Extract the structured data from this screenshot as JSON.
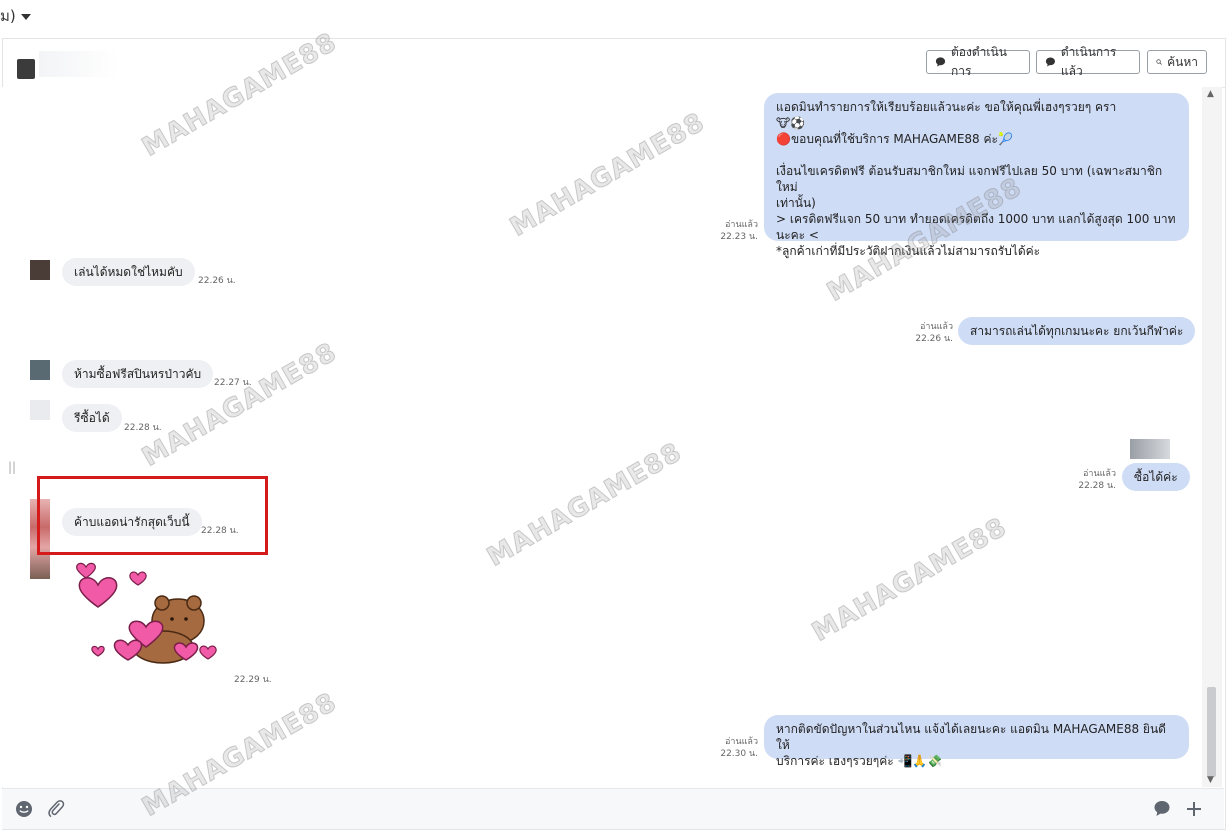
{
  "topbar": {
    "selector_text": "ม)"
  },
  "header": {
    "btn_pending": "ต้องดำเนินการ",
    "btn_done": "ดำเนินการแล้ว",
    "btn_search": "ค้นหา"
  },
  "messages": {
    "m1": {
      "lines": [
        "แอดมินทำรายการให้เรียบร้อยแล้วนะค่ะ ขอให้คุณพี่เฮงๆรวยๆ ครา",
        "🐮⚽",
        "🔴ขอบคุณที่ใช้บริการ MAHAGAME88 ค่ะ🎾",
        "",
        "เงื่อนไขเครดิตฟรี ต้อนรับสมาชิกใหม่ แจกฟรีไปเลย 50 บาท (เฉพาะสมาชิกใหม่",
        "เท่านั้น)",
        "> เครดิตฟรีแจก 50 บาท ทำยอดเครดิตถึง 1000 บาท แลกได้สูงสุด 100 บาท",
        "นะคะ <",
        "*ลูกค้าเก่าที่มีประวัติฝากเงินแล้วไม่สามารถรับได้ค่ะ"
      ],
      "read": "อ่านแล้ว",
      "time": "22.23 น."
    },
    "m2": {
      "text": "เล่นได้หมดใช่ไหมคับ",
      "time": "22.26 น."
    },
    "m3": {
      "text": "สามารถเล่นได้ทุกเกมนะคะ ยกเว้นกีฬาค่ะ",
      "read": "อ่านแล้ว",
      "time": "22.26 น."
    },
    "m4": {
      "text": "ห้ามซื้อฟรีสปินหรป่าวคับ",
      "time": "22.27 น."
    },
    "m5": {
      "text": "รีซื้อได้",
      "time": "22.28 น."
    },
    "m6": {
      "text": "ซื้อได้ค่ะ",
      "read": "อ่านแล้ว",
      "time": "22.28 น."
    },
    "m7": {
      "text": "ค้าบแอดน่ารักสุดเว็บนี้",
      "time": "22.28 น."
    },
    "m8": {
      "time": "22.29 น."
    },
    "m9": {
      "lines": [
        "หากติดขัดปัญหาในส่วนไหน แจ้งได้เลยนะคะ แอดมิน MAHAGAME88 ยินดีให้",
        "บริการค่ะ เฮงๆรวยๆค่ะ 📲🙏💸"
      ],
      "read": "อ่านแล้ว",
      "time": "22.30 น."
    }
  },
  "watermark": "MAHAGAME88",
  "colors": {
    "out_bubble": "#cfdcf6",
    "in_bubble": "#eef0f3",
    "highlight": "#d41a1a"
  },
  "icons": {
    "emoji": "smiley-icon",
    "attach": "paperclip-icon",
    "chat": "chat-bubble-icon",
    "add": "plus-icon"
  }
}
